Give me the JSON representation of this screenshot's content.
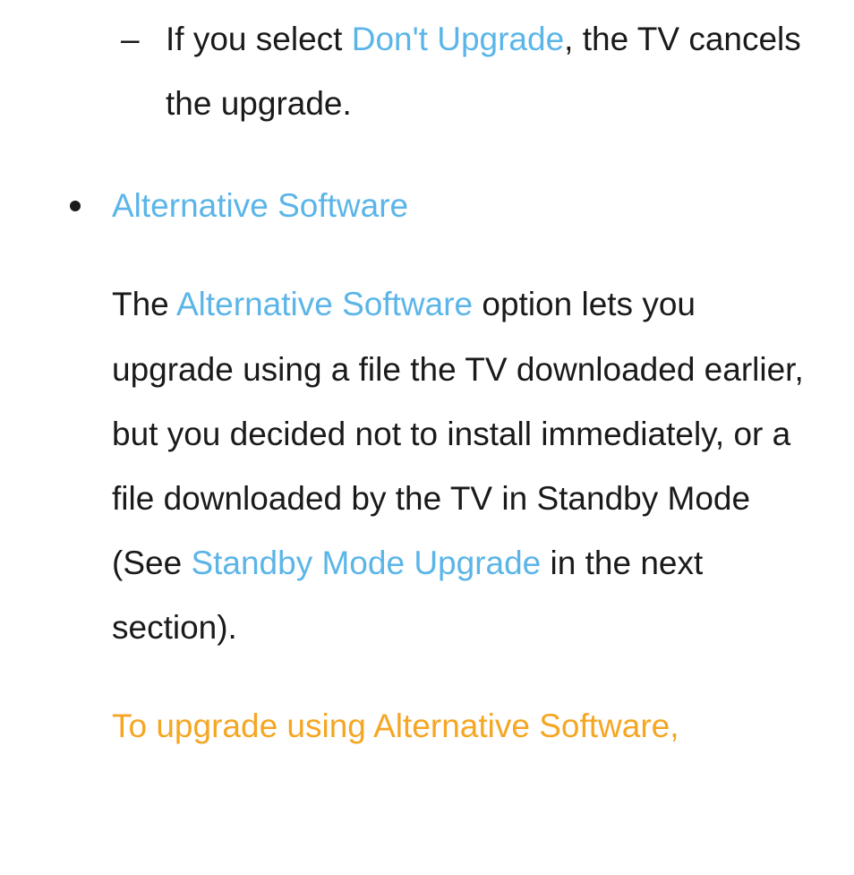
{
  "dashItem": {
    "marker": "–",
    "prefix": "If you select ",
    "link": "Don't Upgrade",
    "suffix": ", the TV cancels the upgrade."
  },
  "bulletHeading": {
    "text": "Alternative Software"
  },
  "bodyPara": {
    "part1": "The ",
    "link1": "Alternative Software",
    "part2": " option lets you upgrade using a file the TV downloaded earlier, but you decided not to install immediately, or a file downloaded by the TV in Standby Mode (See ",
    "link2": "Standby Mode Upgrade",
    "part3": " in the next section)."
  },
  "footerPara": {
    "text": "To upgrade using Alternative Software,"
  }
}
